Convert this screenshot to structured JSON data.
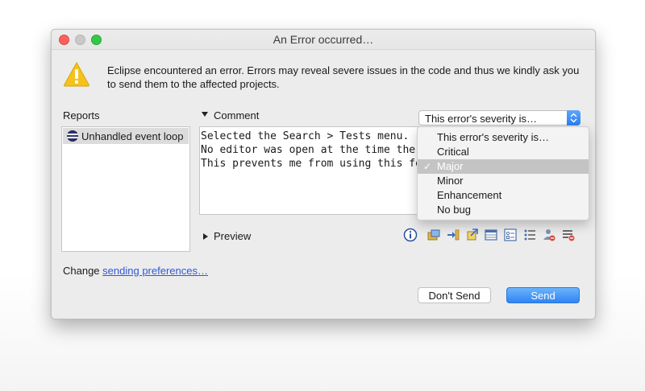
{
  "window": {
    "title": "An Error occurred…"
  },
  "message": {
    "text": "Eclipse encountered an error. Errors may reveal severe issues in the code and thus we kindly ask you to send them to the affected projects.",
    "icon": "warning-icon"
  },
  "reports": {
    "label": "Reports",
    "items": [
      {
        "label": "Unhandled event loop",
        "icon": "eclipse-icon"
      }
    ]
  },
  "comment": {
    "label": "Comment",
    "lines": [
      "Selected the Search > Tests menu.",
      "No editor was open at the time the",
      "This prevents me from using this fe"
    ]
  },
  "severity": {
    "selected_value": "This error's severity is…",
    "options": [
      {
        "label": "This error's severity is…",
        "selected": false
      },
      {
        "label": "Critical",
        "selected": false
      },
      {
        "label": "Major",
        "selected": true
      },
      {
        "label": "Minor",
        "selected": false
      },
      {
        "label": "Enhancement",
        "selected": false
      },
      {
        "label": "No bug",
        "selected": false
      }
    ],
    "check_mark": "✓"
  },
  "preview": {
    "label": "Preview"
  },
  "footer": {
    "change_prefix": "Change",
    "change_link": "sending preferences…"
  },
  "buttons": {
    "dont_send": "Don't Send",
    "send": "Send"
  },
  "colors": {
    "accent": "#2f84f3",
    "link": "#2f58d8",
    "warning": "#f5c21c"
  }
}
